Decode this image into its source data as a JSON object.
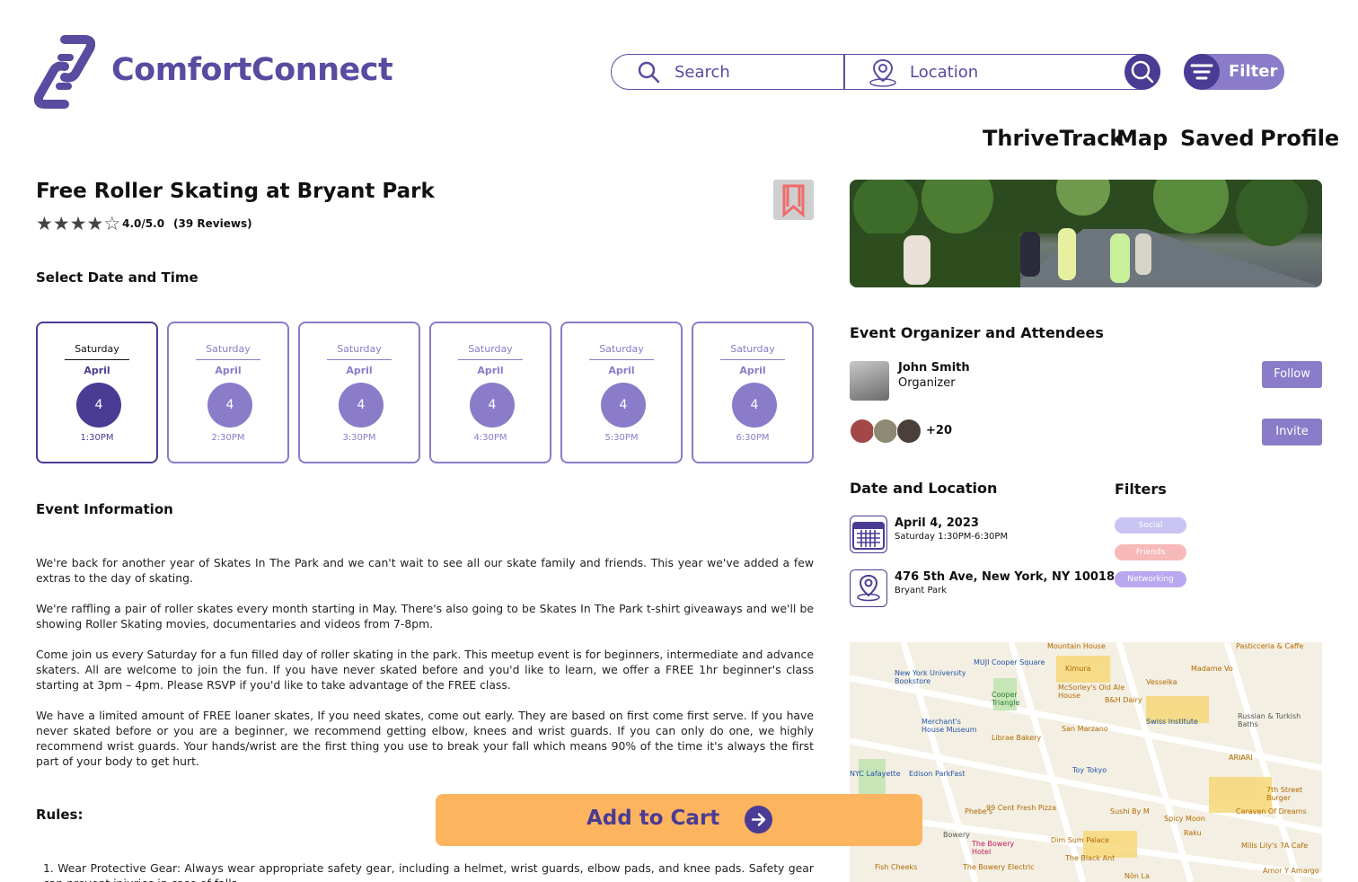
{
  "header": {
    "logo": "ComfortConnect",
    "search_placeholder": "Search",
    "location_placeholder": "Location",
    "filter_label": "Filter"
  },
  "nav": {
    "items": [
      "ThriveTrack",
      "Map",
      "Saved",
      "Profile"
    ]
  },
  "event": {
    "title": "Free Roller Skating at Bryant Park",
    "rating_value": 4,
    "rating_text": "4.0/5.0",
    "reviews": "(39 Reviews)"
  },
  "date_section": {
    "heading": "Select Date and Time",
    "slots": [
      {
        "day": "Saturday",
        "month": "April",
        "date": "4",
        "time": "1:30PM",
        "selected": true
      },
      {
        "day": "Saturday",
        "month": "April",
        "date": "4",
        "time": "2:30PM",
        "selected": false
      },
      {
        "day": "Saturday",
        "month": "April",
        "date": "4",
        "time": "3:30PM",
        "selected": false
      },
      {
        "day": "Saturday",
        "month": "April",
        "date": "4",
        "time": "4:30PM",
        "selected": false
      },
      {
        "day": "Saturday",
        "month": "April",
        "date": "4",
        "time": "5:30PM",
        "selected": false
      },
      {
        "day": "Saturday",
        "month": "April",
        "date": "4",
        "time": "6:30PM",
        "selected": false
      }
    ]
  },
  "info": {
    "heading": "Event Information",
    "paragraphs": [
      "We're back for another year of Skates In The Park and we can't wait to see all our skate family and friends. This year we've added a few extras to the day of skating.",
      "We're raffling a pair of roller skates every month starting in May. There's also going to be Skates In The Park t-shirt giveaways and we'll be showing Roller Skating movies, documentaries and videos from 7-8pm.",
      "Come join us every Saturday for a fun filled day of roller skating in the park. This meetup event is for beginners, intermediate and advance skaters. All are welcome to join the fun. If you have never skated before and you'd like to learn, we offer a FREE 1hr beginner's class starting at 3pm – 4pm. Please RSVP if you'd like to take advantage of the FREE class.",
      "We have a limited amount of FREE loaner skates, If you need skates, come out early. They are based on first come first serve. If you have never skated before or you are a beginner, we recommend getting elbow, knees and wrist guards. If you can only do one, we highly recommend wrist guards. Your hands/wrist are the first thing you use to break your fall which means 90% of the time it's always the first part of your body to get hurt."
    ]
  },
  "rules": {
    "heading": "Rules:",
    "items": [
      "Wear Protective Gear: Always wear appropriate safety gear, including a helmet, wrist guards, elbow pads, and knee pads. Safety gear can prevent injuries in case of falls."
    ]
  },
  "organizer": {
    "heading": "Event Organizer and Attendees",
    "name": "John Smith",
    "role": "Organizer",
    "follow_label": "Follow",
    "attendees_more": "+20",
    "invite_label": "Invite"
  },
  "date_location": {
    "heading": "Date and Location",
    "date": "April 4, 2023",
    "time": "Saturday 1:30PM-6:30PM",
    "address": "476 5th Ave, New York, NY 10018",
    "place": "Bryant Park"
  },
  "filters": {
    "heading": "Filters",
    "tags": [
      {
        "label": "Social",
        "color": "#c9c4f3"
      },
      {
        "label": "Friends",
        "color": "#f7b8b8"
      },
      {
        "label": "Networking",
        "color": "#b9a8f0"
      }
    ]
  },
  "map": {
    "labels": [
      "Mountain House",
      "Pasticceria & Caffe",
      "MUJI Cooper Square",
      "New York University Bookstore",
      "Kimura",
      "Vesselka",
      "Madame Vo",
      "Cooper Triangle",
      "McSorley's Old Ale House",
      "B&H Dairy",
      "Merchant's House Museum",
      "Librae Bakery",
      "Swiss Institute",
      "San Marzano",
      "Russian & Turkish Baths",
      "ARIARI",
      "Edison ParkFast",
      "Toy Tokyo",
      "7th Street Burger",
      "NYC Lafayette",
      "99 Cent Fresh Pizza",
      "Sushi By M",
      "Spicy Moon",
      "Phebe's",
      "Caravan Of Dreams",
      "Dim Sum Palace",
      "Raku",
      "Mills Lily's 7A Cafe",
      "The Bowery Hotel",
      "The Black Ant",
      "Fish Cheeks",
      "The Bowery Electric",
      "Amor Y Amargo",
      "Nòn La",
      "Bowery"
    ]
  },
  "cart": {
    "label": "Add to Cart"
  }
}
